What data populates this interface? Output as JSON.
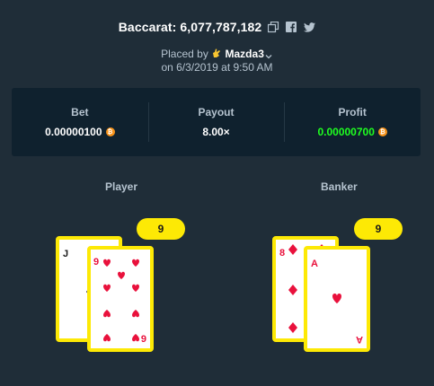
{
  "header": {
    "title": "Baccarat: 6,077,787,182",
    "icons": [
      "copy-icon",
      "facebook-icon",
      "twitter-icon"
    ]
  },
  "placed": {
    "prefix": "Placed by",
    "username": "Mazda3",
    "date": "on 6/3/2019 at 9:50 AM"
  },
  "stats": {
    "bet_label": "Bet",
    "bet_value": "0.00000100",
    "payout_label": "Payout",
    "payout_value": "8.00×",
    "profit_label": "Profit",
    "profit_value": "0.00000700",
    "currency_icon": "bitcoin-icon"
  },
  "player": {
    "label": "Player",
    "score": "9",
    "cards": [
      {
        "rank": "J",
        "suit": "spades"
      },
      {
        "rank": "9",
        "suit": "hearts"
      }
    ]
  },
  "banker": {
    "label": "Banker",
    "score": "9",
    "cards": [
      {
        "rank": "8",
        "suit": "diamonds"
      },
      {
        "rank": "A",
        "suit": "hearts"
      }
    ]
  },
  "colors": {
    "background": "#1f2d38",
    "panel": "#0f212e",
    "accent_yellow": "#fde905",
    "profit_green": "#1fff20",
    "suit_red": "#e9113c"
  }
}
